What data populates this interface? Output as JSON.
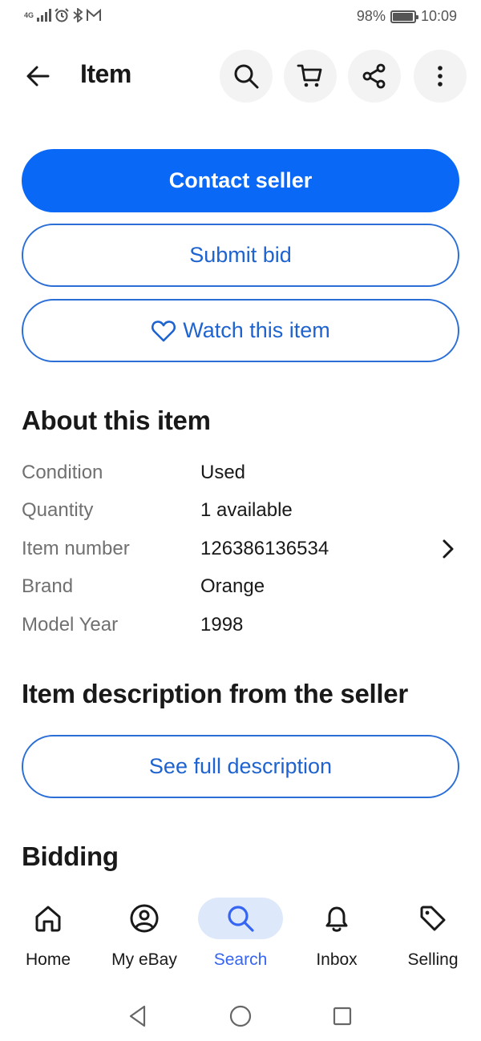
{
  "status_bar": {
    "network": "4G",
    "battery_text": "98%",
    "battery_level": 0.98,
    "time": "10:09",
    "icons": [
      "signal-icon",
      "alarm-icon",
      "bluetooth-icon",
      "mail-icon"
    ]
  },
  "header": {
    "title": "Item",
    "actions": [
      "search-icon",
      "cart-icon",
      "share-icon",
      "more-vertical-icon"
    ]
  },
  "actions": {
    "contact_seller": "Contact seller",
    "submit_bid": "Submit bid",
    "watch_item": "Watch this item"
  },
  "about": {
    "title": "About this item",
    "rows": [
      {
        "label": "Condition",
        "value": "Used"
      },
      {
        "label": "Quantity",
        "value": "1 available"
      },
      {
        "label": "Item number",
        "value": "126386136534"
      },
      {
        "label": "Brand",
        "value": "Orange"
      },
      {
        "label": "Model Year",
        "value": "1998"
      }
    ]
  },
  "description": {
    "title": "Item description from the seller",
    "button": "See full description"
  },
  "bidding": {
    "title": "Bidding"
  },
  "bottom_nav": {
    "items": [
      {
        "label": "Home",
        "icon": "home-icon"
      },
      {
        "label": "My eBay",
        "icon": "user-icon"
      },
      {
        "label": "Search",
        "icon": "search-icon",
        "active": true
      },
      {
        "label": "Inbox",
        "icon": "bell-icon"
      },
      {
        "label": "Selling",
        "icon": "tag-icon"
      }
    ]
  },
  "colors": {
    "primary": "#0968f6",
    "link": "#3665f3",
    "text": "#191919",
    "muted": "#707070"
  }
}
